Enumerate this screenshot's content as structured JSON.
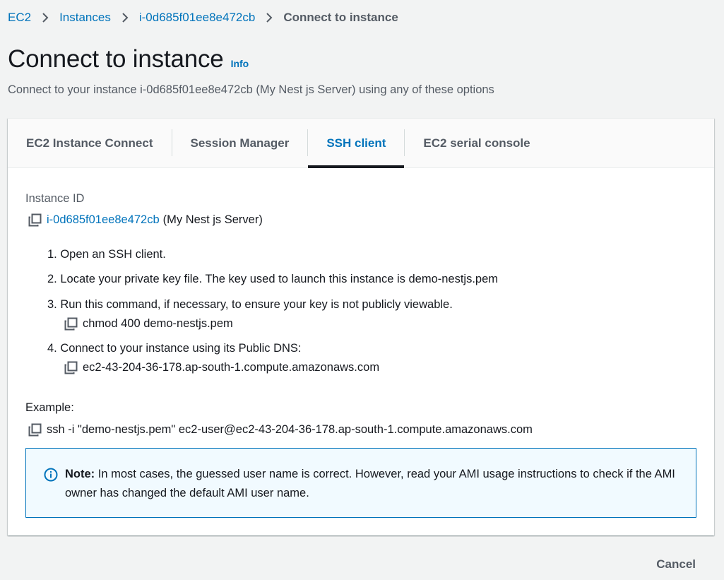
{
  "breadcrumb": {
    "items": [
      "EC2",
      "Instances",
      "i-0d685f01ee8e472cb"
    ],
    "current": "Connect to instance"
  },
  "header": {
    "title": "Connect to instance",
    "info_label": "Info",
    "subtitle": "Connect to your instance i-0d685f01ee8e472cb (My Nest js Server) using any of these options"
  },
  "tabs": [
    {
      "label": "EC2 Instance Connect"
    },
    {
      "label": "Session Manager"
    },
    {
      "label": "SSH client"
    },
    {
      "label": "EC2 serial console"
    }
  ],
  "active_tab": "SSH client",
  "instance": {
    "label": "Instance ID",
    "id": "i-0d685f01ee8e472cb",
    "name": "(My Nest js Server)"
  },
  "steps": [
    {
      "text": "1. Open an SSH client."
    },
    {
      "text": "2. Locate your private key file. The key used to launch this instance is demo-nestjs.pem"
    },
    {
      "text": "3. Run this command, if necessary, to ensure your key is not publicly viewable.",
      "command": "chmod 400 demo-nestjs.pem"
    },
    {
      "text": "4. Connect to your instance using its Public DNS:",
      "command": "ec2-43-204-36-178.ap-south-1.compute.amazonaws.com"
    }
  ],
  "example": {
    "label": "Example:",
    "command": "ssh -i \"demo-nestjs.pem\" ec2-user@ec2-43-204-36-178.ap-south-1.compute.amazonaws.com"
  },
  "note": {
    "title": "Note:",
    "body": "In most cases, the guessed user name is correct. However, read your AMI usage instructions to check if the AMI owner has changed the default AMI user name."
  },
  "footer": {
    "cancel_label": "Cancel"
  },
  "colors": {
    "link": "#0073bb",
    "text": "#16191f",
    "muted": "#545b64",
    "background": "#f2f3f3",
    "note_bg": "#f1faff"
  }
}
